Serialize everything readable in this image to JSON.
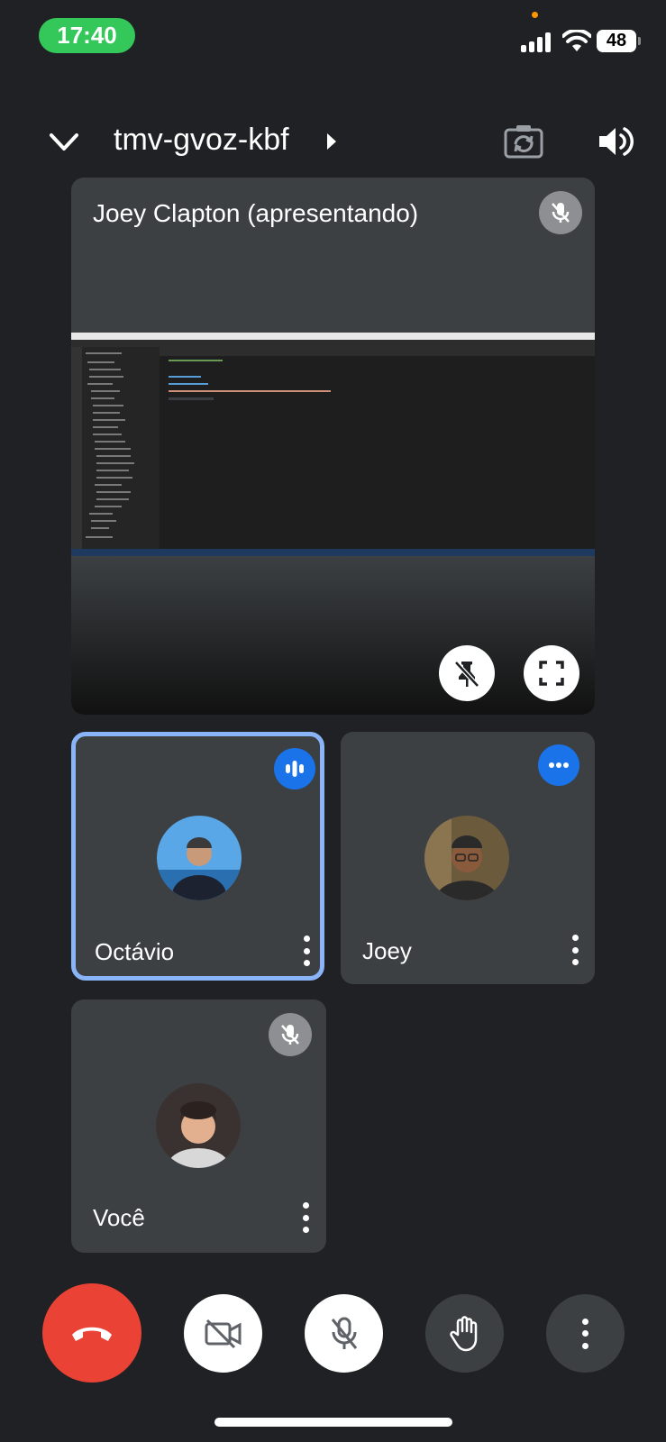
{
  "status_bar": {
    "time": "17:40",
    "battery": "48"
  },
  "header": {
    "meeting_code": "tmv-gvoz-kbf"
  },
  "presenter_tile": {
    "name": "Joey Clapton (apresentando)"
  },
  "participants": [
    {
      "name": "Octávio",
      "status": "speaking"
    },
    {
      "name": "Joey",
      "status": "more"
    },
    {
      "name": "Você",
      "status": "muted"
    }
  ],
  "colors": {
    "background": "#202124",
    "tile": "#3c4043",
    "hangup": "#ea4335",
    "accent": "#1a73e8",
    "active_outline": "#8ab4f8"
  }
}
